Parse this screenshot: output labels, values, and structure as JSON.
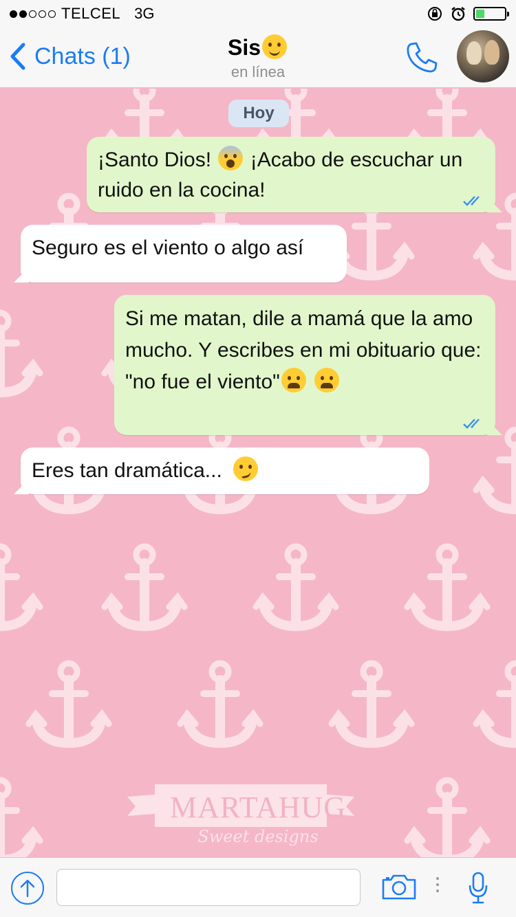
{
  "status_bar": {
    "carrier": "TELCEL",
    "network": "3G",
    "signal_bars_filled": 2,
    "signal_bars_total": 5,
    "battery_level": 0.3,
    "battery_color": "#4cd964"
  },
  "nav": {
    "back_label": "Chats (1)",
    "title": "Sis",
    "title_emoji": "smiling-face-emoji",
    "subtitle": "en línea"
  },
  "chat": {
    "date_label": "Hoy",
    "messages": [
      {
        "direction": "out",
        "parts": [
          "¡Santo Dios!",
          "¡Acabo de escuchar un ruido en la cocina!"
        ],
        "emoji": "face-screaming-emoji",
        "read": true
      },
      {
        "direction": "in",
        "text": "Seguro es el viento o algo así"
      },
      {
        "direction": "out",
        "parts": [
          "Si me matan, dile a mamá que la amo mucho. Y escribes en mi obituario que: \"no fue el viento\""
        ],
        "emoji": "loudly-crying-face-emoji",
        "read": true
      },
      {
        "direction": "in",
        "text": "Eres tan dramática...",
        "emoji": "smirking-face-emoji"
      }
    ],
    "watermark_title": "MARTAHUG",
    "watermark_subtitle": "Sweet designs"
  },
  "input": {
    "value": "",
    "placeholder": ""
  },
  "colors": {
    "accent": "#1a7cf5",
    "outgoing_bubble": "#e1f7cb",
    "incoming_bubble": "#ffffff",
    "wallpaper": "#f5b7c7",
    "read_ticks": "#3b8ee8"
  }
}
